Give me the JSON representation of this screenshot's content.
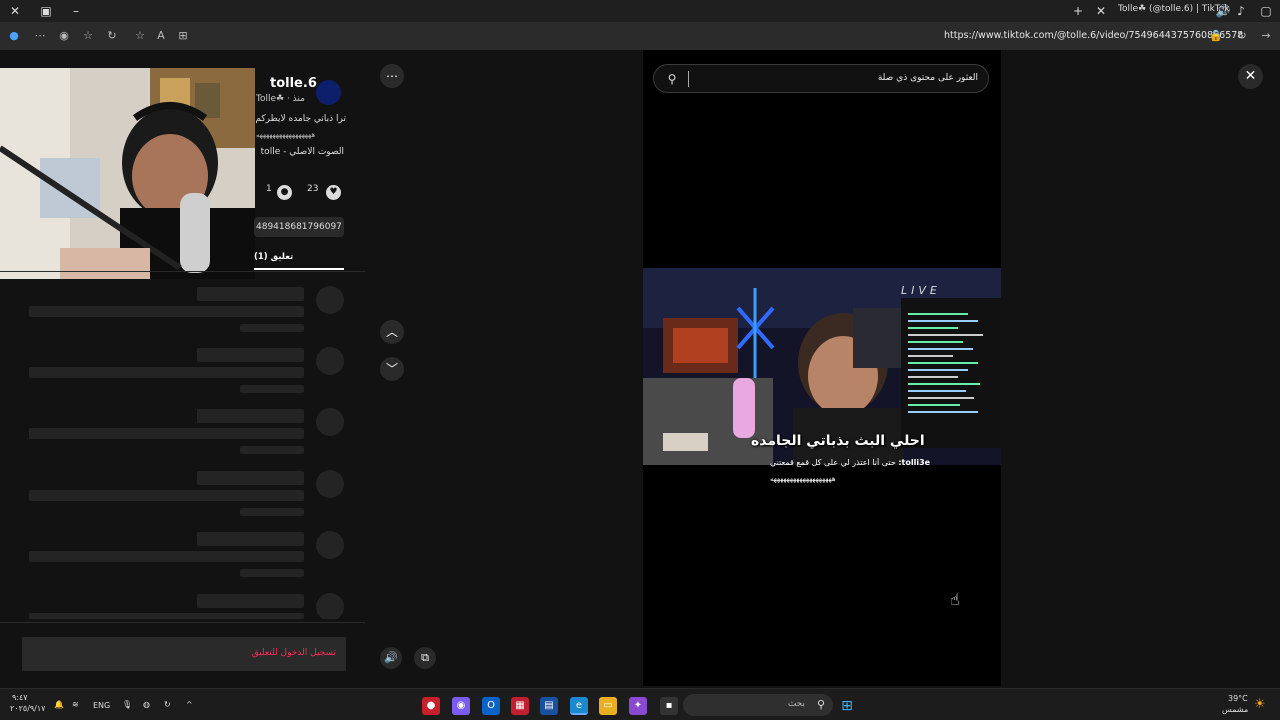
{
  "browser": {
    "tab_title": "Tolle☘ (@tolle.6) | TikTok",
    "url": "https://www.tiktok.com/@tolle.6/video/7549644375760866578"
  },
  "panel": {
    "author_name": "tolle.6",
    "author_sub": "Tolle☘ · منذ",
    "caption": "ترا ذباتي جامده لايطركم ج",
    "hashline": "هههههههههههههههههه",
    "sound": "الصوت الأصلي - tolle",
    "comment_count": "1",
    "like_count": "23",
    "link_text": "489418681796097",
    "comments_tab": "(1) تعليق",
    "login_prompt": "تسجيل الدخول للتعليق"
  },
  "video": {
    "search_placeholder": "العثور على محتوى ذي صلة",
    "overlay_text": "احلي البث بذباتي الجامده",
    "live_label": "LIVE",
    "chat_user": "tolli3e:",
    "chat_message": "حتى أنا اعتذر لي على كل قمع قمعتني",
    "chat_hash": "هههههههههههههههههههه"
  },
  "taskbar": {
    "time": "٩:٤٧",
    "date": "٢٠٢٥/٩/١٧",
    "lang": "ENG",
    "search_label": "بحث",
    "weather_temp": "39°C",
    "weather_desc": "مشمس"
  },
  "colors": {
    "accent": "#fe2c55",
    "background": "#121212"
  }
}
